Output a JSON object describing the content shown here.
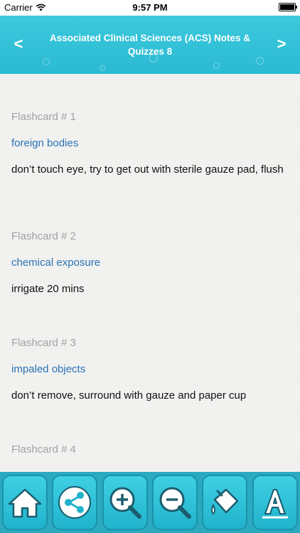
{
  "statusbar": {
    "carrier": "Carrier",
    "time": "9:57 PM"
  },
  "header": {
    "title": "Associated Clinical Sciences (ACS) Notes & Quizzes 8",
    "prev_label": "<",
    "next_label": ">"
  },
  "cards": [
    {
      "label": "Flashcard # 1",
      "term": "foreign bodies",
      "definition": "don’t touch eye, try to get out with sterile gauze pad, flush"
    },
    {
      "label": "Flashcard # 2",
      "term": "chemical exposure",
      "definition": "irrigate 20 mins"
    },
    {
      "label": "Flashcard # 3",
      "term": "impaled objects",
      "definition": "don’t remove, surround with gauze and paper cup"
    },
    {
      "label": "Flashcard # 4",
      "term": "",
      "definition": ""
    }
  ],
  "toolbar": {
    "buttons": [
      {
        "icon": "home-icon"
      },
      {
        "icon": "share-icon"
      },
      {
        "icon": "zoom-in-icon"
      },
      {
        "icon": "zoom-out-icon"
      },
      {
        "icon": "paint-bucket-icon"
      },
      {
        "icon": "font-icon"
      }
    ]
  },
  "colors": {
    "accent": "#2bbad3",
    "term": "#2a73b5",
    "label": "#a2a2a2"
  }
}
